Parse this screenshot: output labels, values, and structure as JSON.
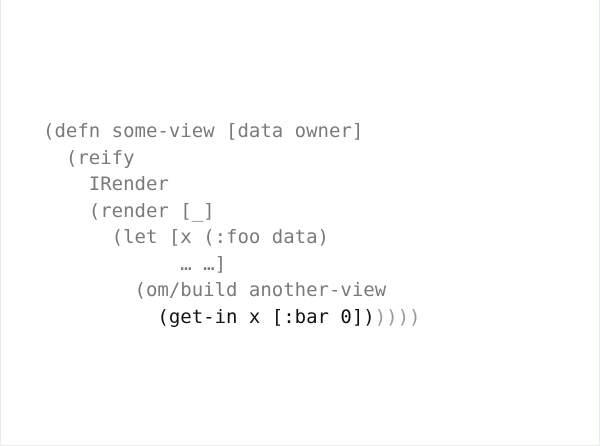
{
  "code": {
    "lines": [
      "(defn some-view [data owner]",
      "  (reify",
      "    IRender",
      "    (render [_]",
      "      (let [x (:foo data)",
      "            … …]",
      "        (om/build another-view"
    ],
    "last_line_indent": "          ",
    "highlight": "(get-in x [:bar 0])",
    "trailing_parens": "))))"
  },
  "colors": {
    "dim_text": "#7a7a7a",
    "highlight_text": "#111111",
    "background": "#ffffff"
  }
}
